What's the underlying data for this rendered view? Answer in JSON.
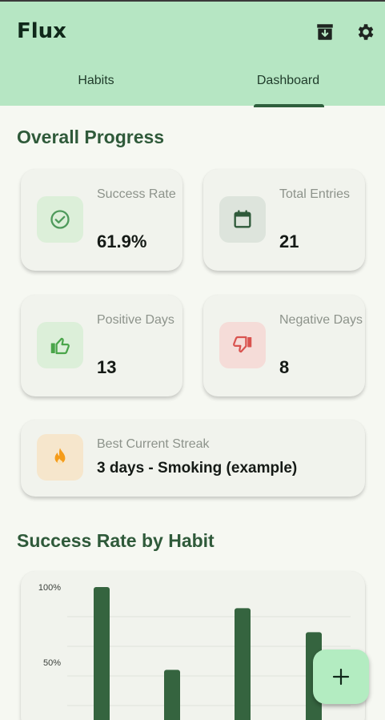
{
  "app": {
    "title": "Flux"
  },
  "header": {
    "actions": [
      {
        "icon": "archive-icon"
      },
      {
        "icon": "gear-icon"
      }
    ]
  },
  "tabs": [
    {
      "label": "Habits",
      "selected": false
    },
    {
      "label": "Dashboard",
      "selected": true
    }
  ],
  "overall": {
    "title": "Overall Progress",
    "stats": [
      {
        "label": "Success Rate",
        "value": "61.9%",
        "icon": "check-circle-icon",
        "accent": "#4f9a5c"
      },
      {
        "label": "Total Entries",
        "value": "21",
        "icon": "calendar-icon",
        "accent": "#2f5a3a"
      },
      {
        "label": "Positive Days",
        "value": "13",
        "icon": "thumbs-up-icon",
        "accent": "#4aa54a"
      },
      {
        "label": "Negative Days",
        "value": "8",
        "icon": "thumbs-down-icon",
        "accent": "#d9534f"
      }
    ],
    "streak": {
      "label": "Best Current Streak",
      "value": "3 days - Smoking (example)",
      "icon": "fire-icon",
      "accent": "#f59c1a"
    }
  },
  "habit_chart": {
    "title": "Success Rate by Habit"
  },
  "chart_data": {
    "type": "bar",
    "title": "Success Rate by Habit",
    "categories": [
      "",
      "",
      "",
      ""
    ],
    "values": [
      100,
      45,
      86,
      70
    ],
    "yticks": [
      "100%",
      "50%"
    ],
    "ylim": [
      0,
      100
    ],
    "grid": true,
    "bar_color": "#35643f"
  },
  "fab": {
    "label": "+"
  },
  "colors": {
    "header_bg": "#b6e6c3",
    "page_bg": "#f6f8f2",
    "card_bg": "#f1f3ed",
    "accent_dark": "#2f5a3a",
    "fab_bg": "#b3ecc1"
  }
}
